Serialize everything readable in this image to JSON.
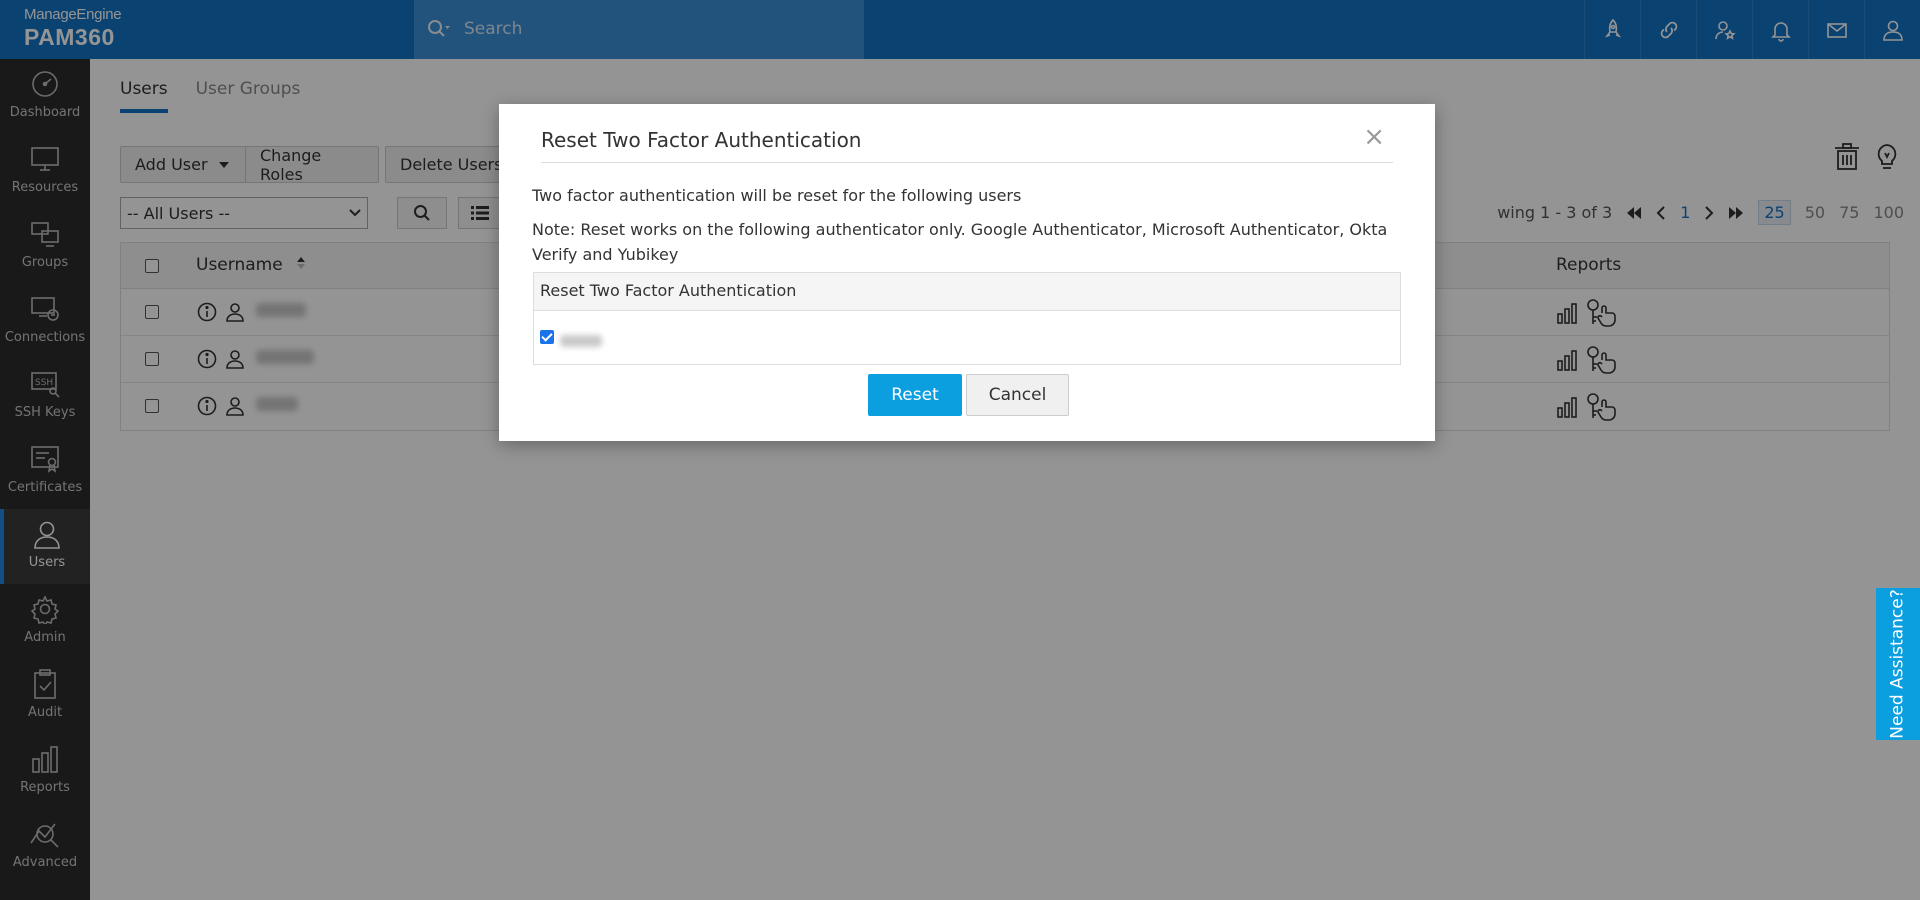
{
  "brand": {
    "vendor": "ManageEngine",
    "product": "PAM360"
  },
  "search": {
    "placeholder": "Search"
  },
  "top_icons": [
    "rocket-icon",
    "link-icon",
    "user-star-icon",
    "bell-icon",
    "mail-icon",
    "user-icon"
  ],
  "sidebar": {
    "items": [
      {
        "label": "Dashboard",
        "icon": "dashboard-icon"
      },
      {
        "label": "Resources",
        "icon": "monitor-icon"
      },
      {
        "label": "Groups",
        "icon": "groups-icon"
      },
      {
        "label": "Connections",
        "icon": "connections-icon"
      },
      {
        "label": "SSH Keys",
        "icon": "ssh-keys-icon"
      },
      {
        "label": "Certificates",
        "icon": "certificate-icon"
      },
      {
        "label": "Users",
        "icon": "user-icon",
        "active": true
      },
      {
        "label": "Admin",
        "icon": "gear-icon"
      },
      {
        "label": "Audit",
        "icon": "clipboard-icon"
      },
      {
        "label": "Reports",
        "icon": "bar-chart-icon"
      },
      {
        "label": "Advanced",
        "icon": "analytics-icon"
      }
    ]
  },
  "main": {
    "tabs": [
      {
        "label": "Users",
        "active": true
      },
      {
        "label": "User Groups",
        "active": false
      }
    ],
    "toolbar": {
      "add_user": "Add User",
      "change_roles": "Change Roles",
      "delete_users": "Delete Users"
    },
    "filter": {
      "selected": "-- All Users --"
    },
    "pager": {
      "showing": "wing 1 - 3 of 3",
      "current_page": "1",
      "page_sizes": [
        "25",
        "50",
        "75",
        "100"
      ],
      "active_size": "25"
    },
    "table": {
      "headers": {
        "username": "Username",
        "reports": "Reports"
      },
      "row_count": 3
    }
  },
  "modal": {
    "title": "Reset Two Factor Authentication",
    "close": "×",
    "text1": "Two factor authentication will be reset for the following users",
    "text2": "Note: Reset works on the following authenticator only. Google Authenticator, Microsoft Authenticator, Okta Verify and Yubikey",
    "table_header": "Reset Two Factor Authentication",
    "reset_label": "Reset",
    "cancel_label": "Cancel"
  },
  "assist": {
    "label": "Need Assistance?"
  },
  "colors": {
    "header": "#1273c4",
    "sidebar": "#2b2b2b",
    "primary_button": "#0b9fe0"
  }
}
